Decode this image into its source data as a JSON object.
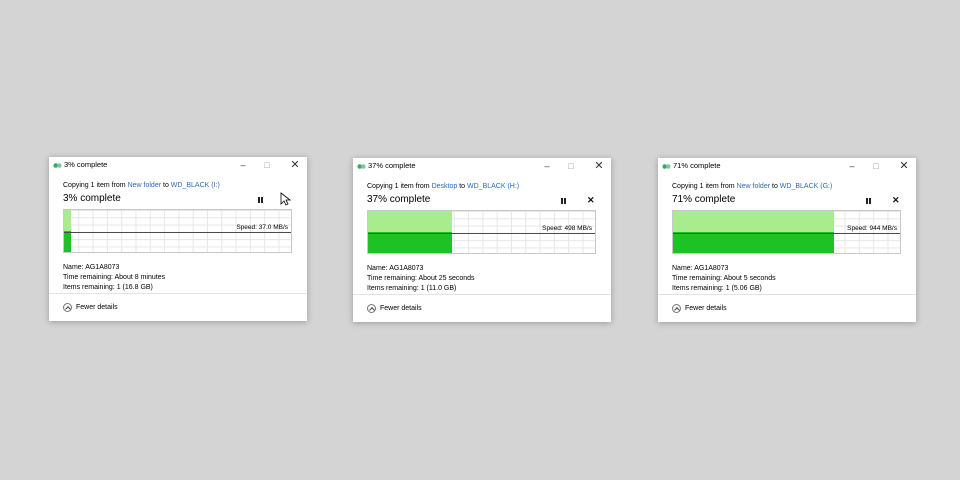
{
  "colors": {
    "background": "#d4d4d4",
    "graph_light": "#a8ec8d",
    "graph_dark": "#1dc324",
    "link": "#2e6bb5"
  },
  "icons": {
    "app": "copy-files-icon",
    "pause": "pause-icon",
    "cancel": "close-icon",
    "fewer": "chevron-up-icon",
    "cursor": "mouse-pointer-icon"
  },
  "dialogs": [
    {
      "title": "3% complete",
      "copy_prefix": "Copying 1 item from ",
      "source": "New folder",
      "to_word": " to ",
      "dest": "WD_BLACK (I:)",
      "percent_label": "3% complete",
      "progress_percent": 3,
      "speed": "Speed: 37.0 MB/s",
      "name_label": "Name:",
      "name_value": "AG1A8073",
      "time_label": "Time remaining:",
      "time_value": "About 8 minutes",
      "items_label": "Items remaining:",
      "items_value": "1 (16.8 GB)",
      "fewer_details": "Fewer details"
    },
    {
      "title": "37% complete",
      "copy_prefix": "Copying 1 item from ",
      "source": "Desktop",
      "to_word": " to ",
      "dest": "WD_BLACK (H:)",
      "percent_label": "37% complete",
      "progress_percent": 37,
      "speed": "Speed: 498 MB/s",
      "name_label": "Name:",
      "name_value": "AG1A8073",
      "time_label": "Time remaining:",
      "time_value": "About 25 seconds",
      "items_label": "Items remaining:",
      "items_value": "1 (11.0 GB)",
      "fewer_details": "Fewer details"
    },
    {
      "title": "71% complete",
      "copy_prefix": "Copying 1 item from ",
      "source": "New folder",
      "to_word": " to ",
      "dest": "WD_BLACK (G:)",
      "percent_label": "71% complete",
      "progress_percent": 71,
      "speed": "Speed: 944 MB/s",
      "name_label": "Name:",
      "name_value": "AG1A8073",
      "time_label": "Time remaining:",
      "time_value": "About 5 seconds",
      "items_label": "Items remaining:",
      "items_value": "1 (5.06 GB)",
      "fewer_details": "Fewer details"
    }
  ]
}
